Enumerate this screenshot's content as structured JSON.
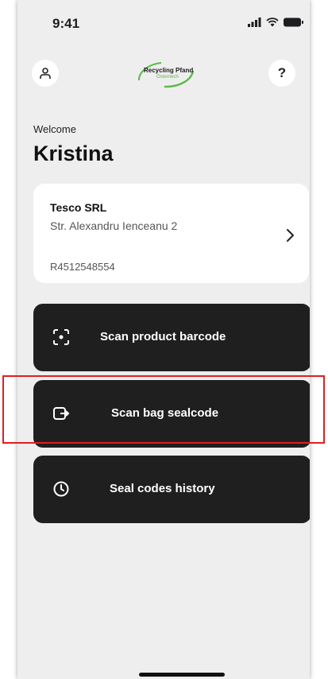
{
  "status_bar": {
    "time": "9:41"
  },
  "header": {
    "logo_text": "Recycling Pfand",
    "logo_subtext": "Österreich",
    "help_label": "?"
  },
  "greeting": {
    "welcome": "Welcome",
    "name": "Kristina"
  },
  "company": {
    "name": "Tesco SRL",
    "address": "Str. Alexandru Ienceanu 2",
    "id": "R4512548554"
  },
  "actions": {
    "scan_barcode": "Scan product barcode",
    "scan_bag": "Scan bag sealcode",
    "history": "Seal codes history"
  },
  "colors": {
    "background": "#eeeeee",
    "card": "#ffffff",
    "button": "#1f1f1f",
    "highlight": "#e01e1e",
    "logo_green": "#5bb84a"
  }
}
